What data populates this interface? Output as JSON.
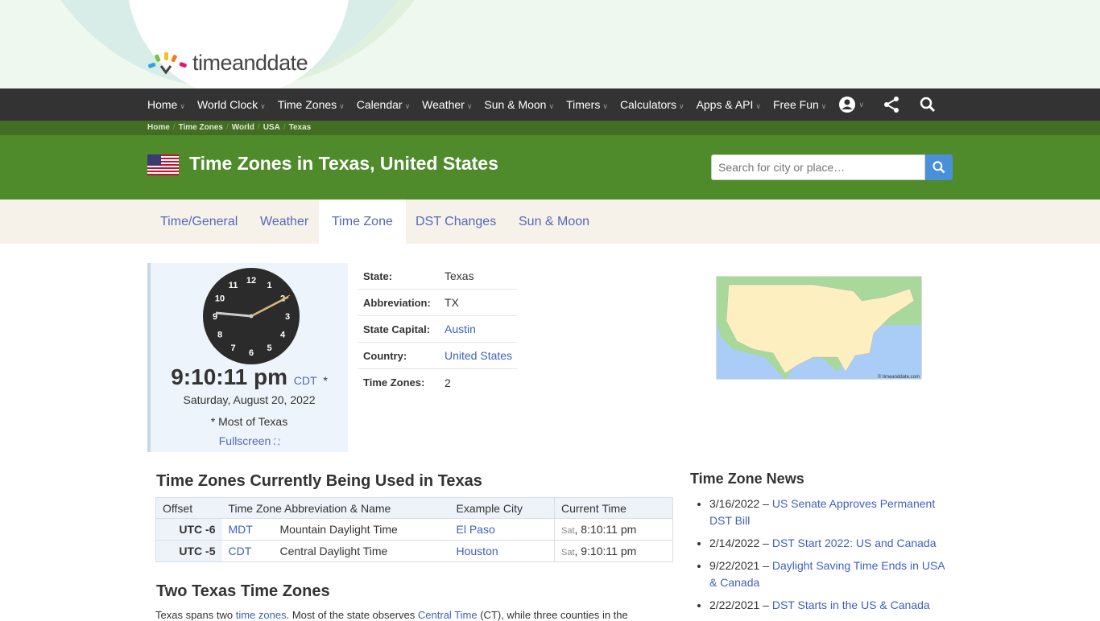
{
  "logo": "timeanddate",
  "nav": [
    {
      "label": "Home"
    },
    {
      "label": "World Clock"
    },
    {
      "label": "Time Zones"
    },
    {
      "label": "Calendar"
    },
    {
      "label": "Weather"
    },
    {
      "label": "Sun & Moon"
    },
    {
      "label": "Timers"
    },
    {
      "label": "Calculators"
    },
    {
      "label": "Apps & API"
    },
    {
      "label": "Free Fun"
    }
  ],
  "breadcrumb": [
    "Home",
    "Time Zones",
    "World",
    "USA",
    "Texas"
  ],
  "page_title": "Time Zones in Texas, United States",
  "search": {
    "placeholder": "Search for city or place…"
  },
  "tabs": [
    {
      "label": "Time/General"
    },
    {
      "label": "Weather"
    },
    {
      "label": "Time Zone",
      "active": true
    },
    {
      "label": "DST Changes"
    },
    {
      "label": "Sun & Moon"
    }
  ],
  "clock": {
    "numbers": [
      "12",
      "1",
      "2",
      "3",
      "4",
      "5",
      "6",
      "7",
      "8",
      "9",
      "10",
      "11"
    ],
    "time": "9:10:11 pm",
    "tz": "CDT",
    "star": "*",
    "date": "Saturday, August 20, 2022",
    "note": "* Most of Texas",
    "fullscreen": "Fullscreen"
  },
  "info": [
    {
      "k": "State:",
      "v": "Texas",
      "link": false
    },
    {
      "k": "Abbreviation:",
      "v": "TX",
      "link": false
    },
    {
      "k": "State Capital:",
      "v": "Austin",
      "link": true
    },
    {
      "k": "Country:",
      "v": "United States",
      "link": true
    },
    {
      "k": "Time Zones:",
      "v": "2",
      "link": false
    }
  ],
  "map_credit": "© timeanddate.com",
  "zones_heading": "Time Zones Currently Being Used in Texas",
  "table": {
    "headers": [
      "Offset",
      "Time Zone Abbreviation & Name",
      "Example City",
      "Current Time"
    ],
    "rows": [
      {
        "offset": "UTC -6",
        "abbr": "MDT",
        "name": "Mountain Daylight Time",
        "city": "El Paso",
        "day": "Sat",
        "time": ", 8:10:11 pm"
      },
      {
        "offset": "UTC -5",
        "abbr": "CDT",
        "name": "Central Daylight Time",
        "city": "Houston",
        "day": "Sat",
        "time": ", 9:10:11 pm"
      }
    ]
  },
  "two_heading": "Two Texas Time Zones",
  "para": {
    "t1": "Texas spans two ",
    "l1": "time zones",
    "t2": ". Most of the state observes ",
    "l2": "Central Time",
    "t3": " (CT), while three counties in the"
  },
  "news": {
    "heading": "Time Zone News",
    "items": [
      {
        "date": "3/16/2022 – ",
        "title": "US Senate Approves Permanent DST Bill"
      },
      {
        "date": "2/14/2022 – ",
        "title": "DST Start 2022: US and Canada"
      },
      {
        "date": "9/22/2021 – ",
        "title": "Daylight Saving Time Ends in USA & Canada"
      },
      {
        "date": "2/22/2021 – ",
        "title": "DST Starts in the US & Canada"
      }
    ]
  },
  "colors": {
    "nav": "#333333",
    "banner": "#4f8a2b",
    "breadcrumb": "#436d22",
    "link": "#3f5fbf",
    "tabs_bg": "#f6f2ea"
  }
}
